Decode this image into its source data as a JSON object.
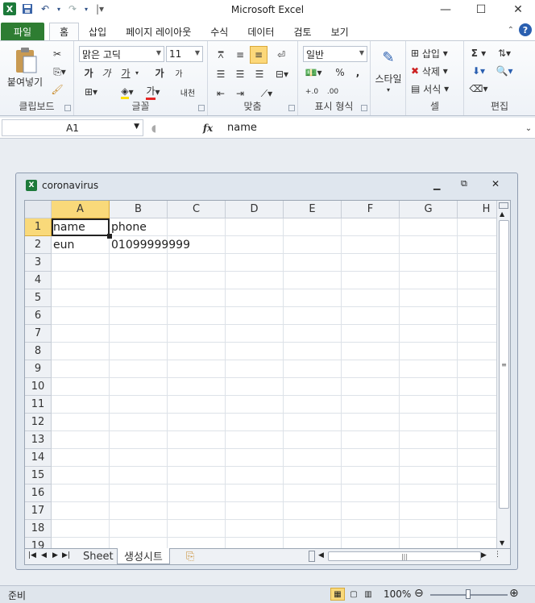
{
  "app": {
    "title": "Microsoft Excel"
  },
  "tabs": {
    "file": "파일",
    "items": [
      "홈",
      "삽입",
      "페이지 레이아웃",
      "수식",
      "데이터",
      "검토",
      "보기"
    ]
  },
  "ribbon": {
    "clipboard": {
      "label": "클립보드",
      "paste": "붙여넣기"
    },
    "font": {
      "label": "글꼴",
      "font_name": "맑은 고딕",
      "font_size": "11",
      "bold": "가",
      "italic": "가",
      "underline": "가",
      "grow": "가",
      "shrink": "가",
      "font_color": "가",
      "phonetic": "내천"
    },
    "alignment": {
      "label": "맞춤"
    },
    "number": {
      "label": "표시 형식",
      "format": "일반",
      "percent": "%",
      "comma": ","
    },
    "styles": {
      "label": "스타일",
      "button": "스타일"
    },
    "cells": {
      "label": "셀",
      "insert": "삽입",
      "delete": "삭제",
      "format": "서식"
    },
    "editing": {
      "label": "편집",
      "sum": "Σ"
    }
  },
  "formula_bar": {
    "name_box": "A1",
    "fx": "fx",
    "value": "name"
  },
  "workbook": {
    "title": "coronavirus",
    "columns": [
      "A",
      "B",
      "C",
      "D",
      "E",
      "F",
      "G",
      "H"
    ],
    "rows": [
      "1",
      "2",
      "3",
      "4",
      "5",
      "6",
      "7",
      "8",
      "9",
      "10",
      "11",
      "12",
      "13",
      "14",
      "15",
      "16",
      "17",
      "18",
      "19"
    ],
    "cells": {
      "A1": "name",
      "B1": "phone",
      "A2": "eun",
      "B2": "01099999999"
    },
    "sheets": [
      "Sheet",
      "생성시트"
    ]
  },
  "status": {
    "ready": "준비",
    "zoom": "100%"
  }
}
